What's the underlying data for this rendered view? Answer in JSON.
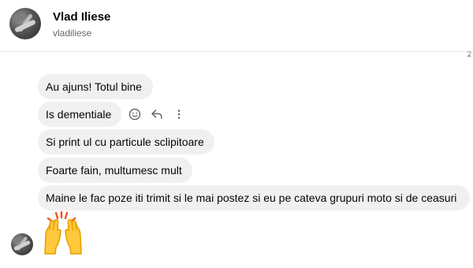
{
  "conversation": {
    "name": "Vlad Iliese",
    "username": "vladiliese"
  },
  "scroll_marker": "2",
  "messages": [
    {
      "text": "Au ajuns! Totul bine"
    },
    {
      "text": "Is dementiale"
    },
    {
      "text": "Si print ul cu particule sclipitoare"
    },
    {
      "text": "Foarte fain, multumesc mult"
    },
    {
      "text": "Maine le fac poze iti trimit si le mai postez si eu pe cateva grupuri moto si de ceasuri"
    }
  ],
  "message_actions": [
    "react-icon",
    "reply-icon",
    "more-options-icon"
  ],
  "emoji_message": {
    "icon": "raising-hands-icon"
  },
  "colors": {
    "bubble_bg": "#f0f0f0",
    "text": "#050505",
    "secondary_text": "#65676b",
    "divider": "#e4e6eb",
    "emoji_yellow": "#ffc83d",
    "emoji_outline": "#e6a100",
    "emoji_red": "#f4511e"
  }
}
